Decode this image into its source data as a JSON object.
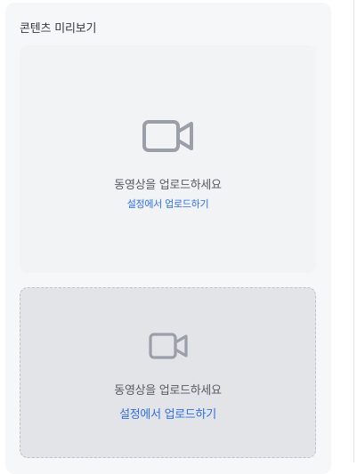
{
  "panel": {
    "title": "콘텐츠 미리보기"
  },
  "cards": [
    {
      "icon": "video-camera-icon",
      "prompt": "동영상을 업로드하세요",
      "link": "설정에서 업로드하기"
    },
    {
      "icon": "video-camera-icon",
      "prompt": "동영상을 업로드하세요",
      "link": "설정에서 업로드하기"
    }
  ],
  "colors": {
    "panel_bg": "#f6f7f9",
    "card_bg": "#f2f3f5",
    "dropzone_bg": "#e3e4e8",
    "icon": "#9a9fa8",
    "link": "#2f6fdc"
  }
}
